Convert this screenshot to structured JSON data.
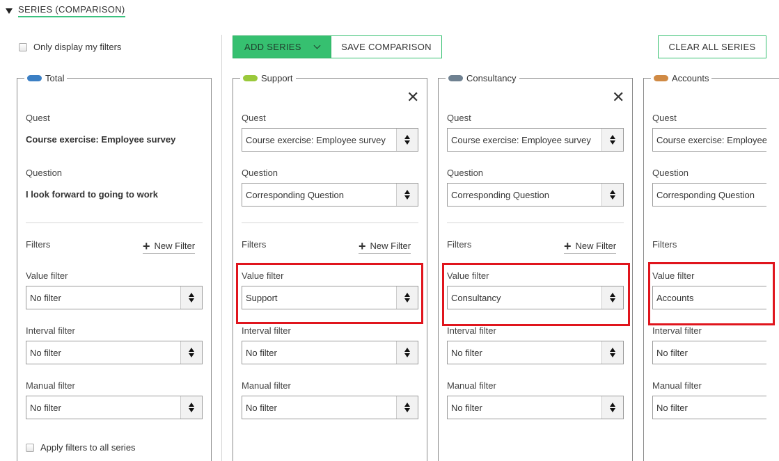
{
  "section": {
    "title": "SERIES (COMPARISON)"
  },
  "only_my_filters": "Only display my filters",
  "toolbar": {
    "add_series": "ADD SERIES",
    "save_comparison": "SAVE COMPARISON",
    "clear_all": "CLEAR ALL SERIES"
  },
  "labels": {
    "quest": "Quest",
    "question": "Question",
    "filters": "Filters",
    "new_filter": "New Filter",
    "value_filter": "Value filter",
    "interval_filter": "Interval filter",
    "manual_filter": "Manual filter"
  },
  "series": [
    {
      "name": "Total",
      "color": "#3b7fc4",
      "quest": "Course exercise: Employee survey",
      "question": "I look forward to going to work",
      "value_filter": "No filter",
      "interval_filter": "No filter",
      "manual_filter": "No filter"
    },
    {
      "name": "Support",
      "color": "#9ac93b",
      "quest": "Course exercise: Employee survey",
      "question": "Corresponding Question",
      "value_filter": "Support",
      "interval_filter": "No filter",
      "manual_filter": "No filter"
    },
    {
      "name": "Consultancy",
      "color": "#6f8191",
      "quest": "Course exercise: Employee survey",
      "question": "Corresponding Question",
      "value_filter": "Consultancy",
      "interval_filter": "No filter",
      "manual_filter": "No filter"
    },
    {
      "name": "Accounts",
      "color": "#d08a44",
      "quest": "Course exercise: Employee survey",
      "question": "Corresponding Question",
      "value_filter": "Accounts",
      "interval_filter": "No filter",
      "manual_filter": "No filter"
    }
  ],
  "apply_all": "Apply filters to all series",
  "highlight_color": "#e0151d"
}
